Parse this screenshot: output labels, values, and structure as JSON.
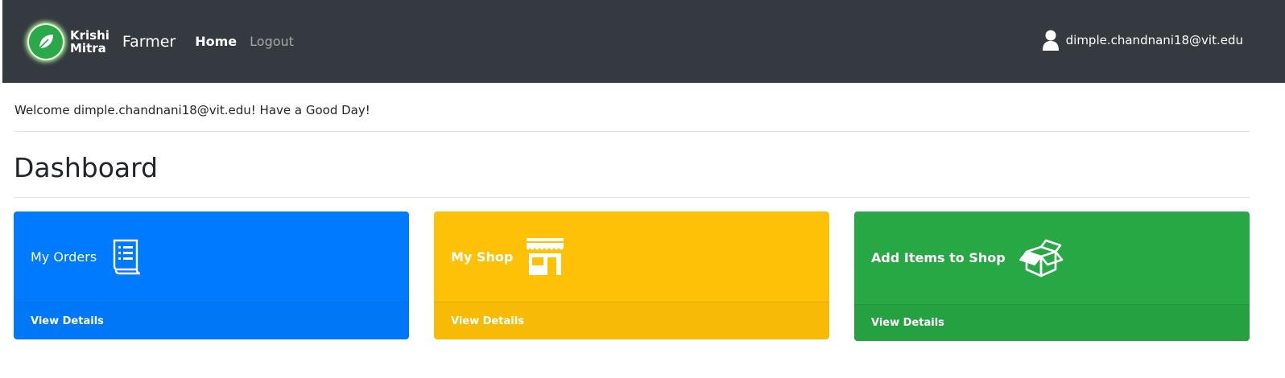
{
  "navbar": {
    "brand_line1": "Krishi",
    "brand_line2": "Mitra",
    "role": "Farmer",
    "home_label": "Home",
    "logout_label": "Logout",
    "user_email": "dimple.chandnani18@vit.edu",
    "icons": {
      "logo": "leaf-logo-icon",
      "user": "user-icon"
    }
  },
  "welcome_text": "Welcome dimple.chandnani18@vit.edu! Have a Good Day!",
  "page_title": "Dashboard",
  "cards": [
    {
      "label": "My Orders",
      "footer": "View Details",
      "icon": "order-list-icon",
      "color": "#007bff"
    },
    {
      "label": "My Shop",
      "footer": "View Details",
      "icon": "shop-storefront-icon",
      "color": "#ffc107"
    },
    {
      "label": "Add Items to Shop",
      "footer": "View Details",
      "icon": "open-box-icon",
      "color": "#28a745"
    }
  ],
  "colors": {
    "navbar_bg": "#343a40",
    "text": "#212529"
  }
}
